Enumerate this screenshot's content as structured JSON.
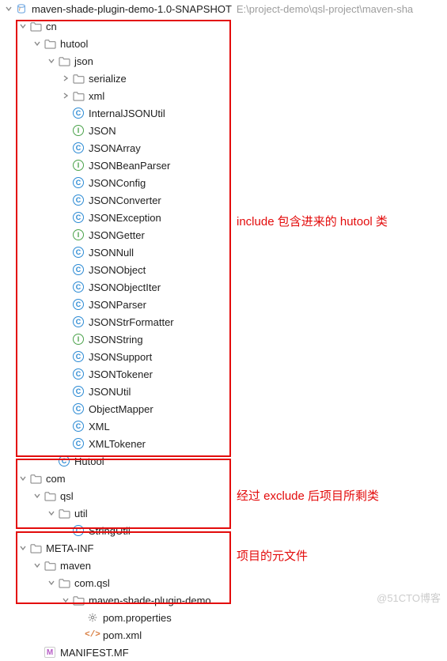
{
  "root": {
    "name": "maven-shade-plugin-demo-1.0-SNAPSHOT",
    "path_hint": "E:\\project-demo\\qsl-project\\maven-sha"
  },
  "cn_tree": {
    "cn": "cn",
    "hutool": "hutool",
    "json": "json",
    "serialize": "serialize",
    "xml": "xml",
    "classes": [
      {
        "icon": "C",
        "name": "InternalJSONUtil"
      },
      {
        "icon": "I",
        "name": "JSON"
      },
      {
        "icon": "C",
        "name": "JSONArray"
      },
      {
        "icon": "I",
        "name": "JSONBeanParser"
      },
      {
        "icon": "C",
        "name": "JSONConfig"
      },
      {
        "icon": "C",
        "name": "JSONConverter"
      },
      {
        "icon": "C",
        "name": "JSONException"
      },
      {
        "icon": "I",
        "name": "JSONGetter"
      },
      {
        "icon": "C",
        "name": "JSONNull"
      },
      {
        "icon": "C",
        "name": "JSONObject"
      },
      {
        "icon": "C",
        "name": "JSONObjectIter"
      },
      {
        "icon": "C",
        "name": "JSONParser"
      },
      {
        "icon": "C",
        "name": "JSONStrFormatter"
      },
      {
        "icon": "I",
        "name": "JSONString"
      },
      {
        "icon": "C",
        "name": "JSONSupport"
      },
      {
        "icon": "C",
        "name": "JSONTokener"
      },
      {
        "icon": "C",
        "name": "JSONUtil"
      },
      {
        "icon": "C",
        "name": "ObjectMapper"
      },
      {
        "icon": "C",
        "name": "XML"
      },
      {
        "icon": "C",
        "name": "XMLTokener"
      }
    ],
    "hutool_class": {
      "icon": "C",
      "name": "Hutool"
    }
  },
  "com_tree": {
    "com": "com",
    "qsl": "qsl",
    "util": "util",
    "string_util": {
      "icon": "C",
      "name": "StringUtil"
    }
  },
  "meta_tree": {
    "meta_inf": "META-INF",
    "maven": "maven",
    "com_qsl": "com.qsl",
    "demo": "maven-shade-plugin-demo",
    "pom_props": "pom.properties",
    "pom_xml": "pom.xml",
    "manifest": "MANIFEST.MF"
  },
  "annotations": {
    "a1": "include 包含进来的 hutool 类",
    "a2": "经过 exclude 后项目所剩类",
    "a3": "项目的元文件"
  },
  "watermark": "@51CTO博客"
}
